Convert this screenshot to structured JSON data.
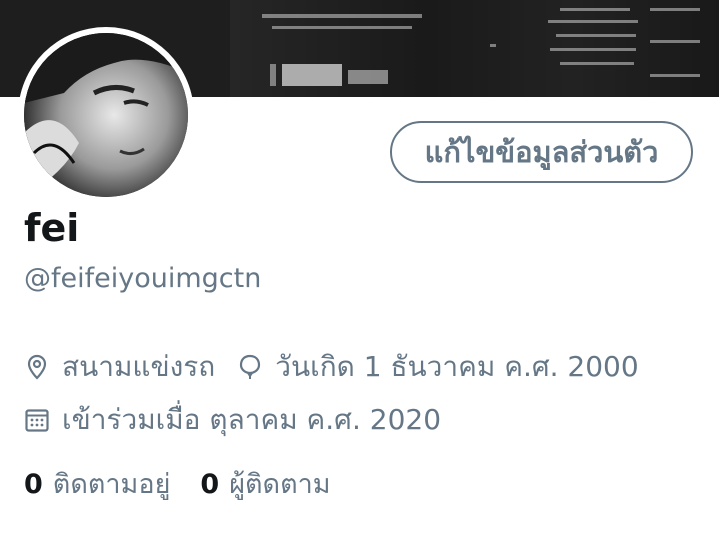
{
  "profile": {
    "name": "fei",
    "handle": "@feifeiyouimgctn",
    "edit_label": "แก้ไขข้อมูลส่วนตัว",
    "location": "สนามแข่งรถ",
    "birthday": "วันเกิด 1 ธันวาคม ค.ศ. 2000",
    "joined": "เข้าร่วมเมื่อ ตุลาคม ค.ศ. 2020"
  },
  "stats": {
    "following_count": "0",
    "following_label": "ติดตามอยู่",
    "followers_count": "0",
    "followers_label": "ผู้ติดตาม"
  },
  "icons": {
    "location": "location-pin-icon",
    "birthday": "balloon-icon",
    "joined": "calendar-icon"
  },
  "colors": {
    "secondary_text": "#657786",
    "primary_text": "#14171a",
    "background": "#ffffff"
  }
}
